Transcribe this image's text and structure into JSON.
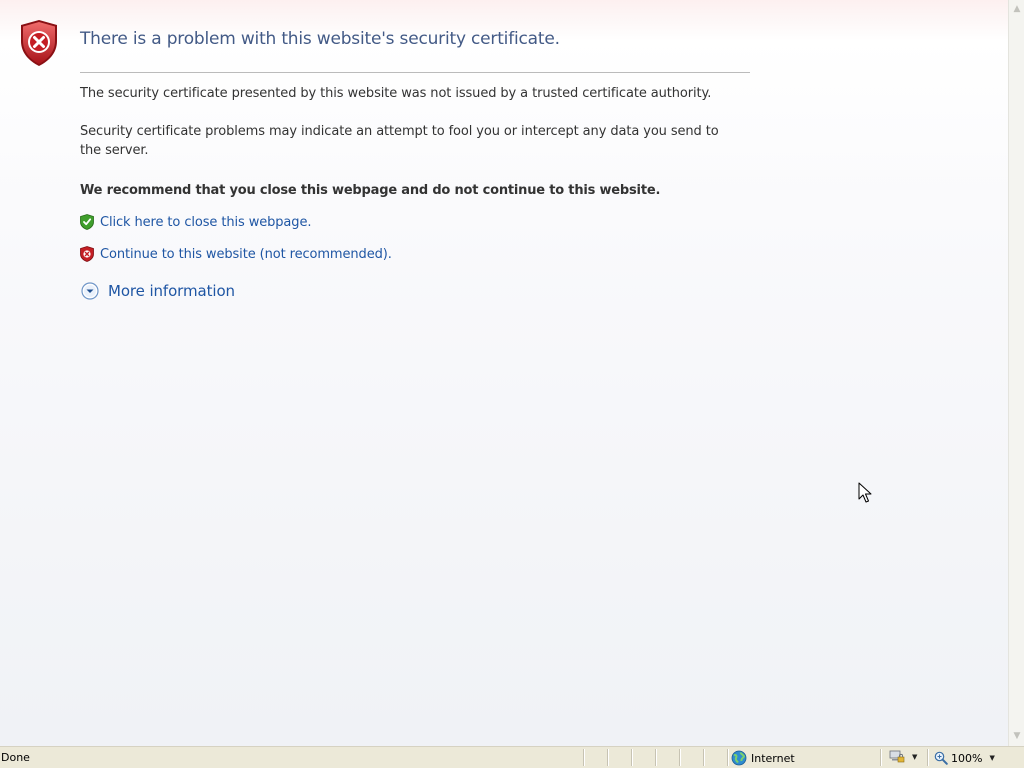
{
  "error": {
    "title": "There is a problem with this website's security certificate.",
    "para1": "The security certificate presented by this website was not issued by a trusted certificate authority.",
    "para2": "Security certificate problems may indicate an attempt to fool you or intercept any data you send to the server.",
    "recommend": "We recommend that you close this webpage and do not continue to this website.",
    "close_link": "Click here to close this webpage.",
    "continue_link": "Continue to this website (not recommended).",
    "more_info": "More information"
  },
  "icons": {
    "header": "shield-error-icon",
    "close": "shield-check-icon",
    "continue": "shield-x-icon",
    "more": "expand-chevron-icon",
    "zone": "globe-icon",
    "protected_mode": "computer-lock-icon",
    "zoom": "magnifier-icon"
  },
  "colors": {
    "title": "#435a86",
    "link": "#1f56a4",
    "shield_red": "#c41e24",
    "shield_green": "#3f9e2c"
  },
  "statusbar": {
    "status": "Done",
    "zone": "Internet",
    "zoom": "100%"
  }
}
